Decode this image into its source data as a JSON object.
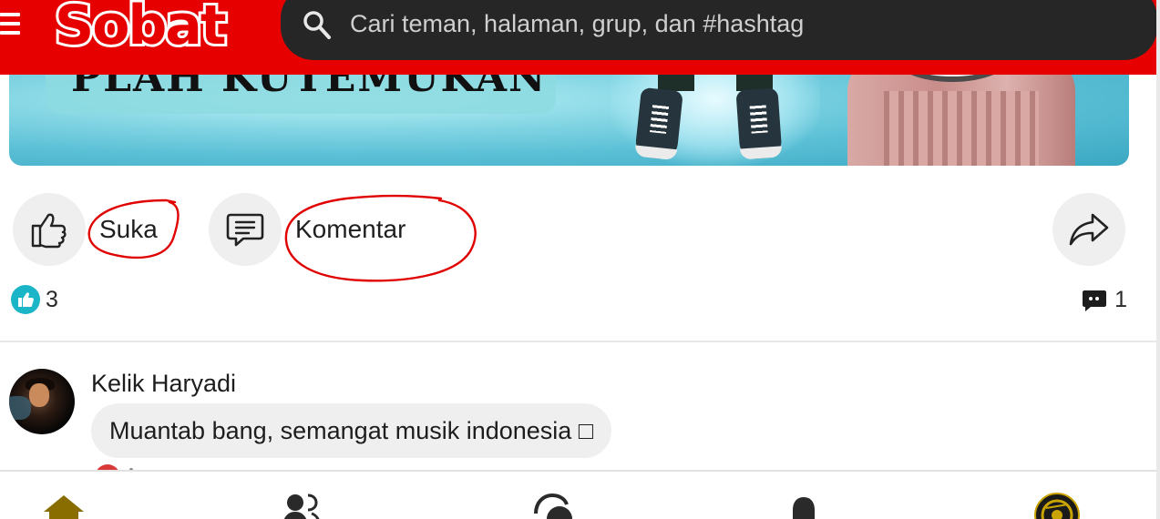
{
  "app": {
    "logo_text": "Sobat",
    "brand_color": "#e60000"
  },
  "search": {
    "placeholder": "Cari teman, halaman, grup, dan #hashtag",
    "icon": "search-icon"
  },
  "post": {
    "image_banner_text": "PLAH KUTEMUKAN",
    "actions": {
      "like_label": "Suka",
      "comment_label": "Komentar",
      "share_icon": "share-icon"
    },
    "like_count": "3",
    "comment_count": "1"
  },
  "comments": [
    {
      "author": "Kelik Haryadi",
      "text": "Muantab bang, semangat musik indonesia □"
    }
  ],
  "bottom_nav": {
    "items": [
      {
        "icon": "home-icon",
        "active_color": "#8a6d00"
      },
      {
        "icon": "friends-icon"
      },
      {
        "icon": "chat-icon"
      },
      {
        "icon": "notification-bell-icon"
      },
      {
        "icon": "profile-avatar-icon"
      }
    ]
  },
  "annotations": {
    "circle_color": "#e00000"
  }
}
